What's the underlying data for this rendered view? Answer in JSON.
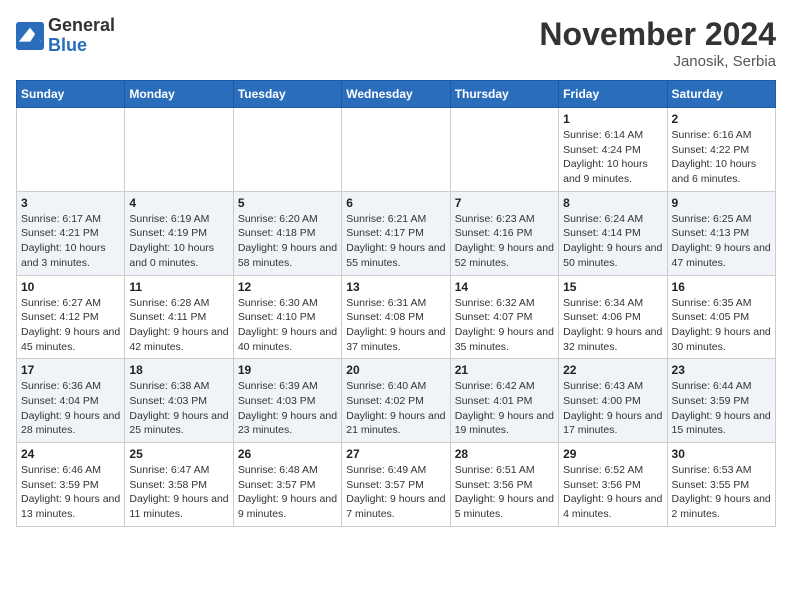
{
  "header": {
    "logo_general": "General",
    "logo_blue": "Blue",
    "month_title": "November 2024",
    "location": "Janosik, Serbia"
  },
  "days_of_week": [
    "Sunday",
    "Monday",
    "Tuesday",
    "Wednesday",
    "Thursday",
    "Friday",
    "Saturday"
  ],
  "weeks": [
    [
      {
        "day": "",
        "info": ""
      },
      {
        "day": "",
        "info": ""
      },
      {
        "day": "",
        "info": ""
      },
      {
        "day": "",
        "info": ""
      },
      {
        "day": "",
        "info": ""
      },
      {
        "day": "1",
        "info": "Sunrise: 6:14 AM\nSunset: 4:24 PM\nDaylight: 10 hours and 9 minutes."
      },
      {
        "day": "2",
        "info": "Sunrise: 6:16 AM\nSunset: 4:22 PM\nDaylight: 10 hours and 6 minutes."
      }
    ],
    [
      {
        "day": "3",
        "info": "Sunrise: 6:17 AM\nSunset: 4:21 PM\nDaylight: 10 hours and 3 minutes."
      },
      {
        "day": "4",
        "info": "Sunrise: 6:19 AM\nSunset: 4:19 PM\nDaylight: 10 hours and 0 minutes."
      },
      {
        "day": "5",
        "info": "Sunrise: 6:20 AM\nSunset: 4:18 PM\nDaylight: 9 hours and 58 minutes."
      },
      {
        "day": "6",
        "info": "Sunrise: 6:21 AM\nSunset: 4:17 PM\nDaylight: 9 hours and 55 minutes."
      },
      {
        "day": "7",
        "info": "Sunrise: 6:23 AM\nSunset: 4:16 PM\nDaylight: 9 hours and 52 minutes."
      },
      {
        "day": "8",
        "info": "Sunrise: 6:24 AM\nSunset: 4:14 PM\nDaylight: 9 hours and 50 minutes."
      },
      {
        "day": "9",
        "info": "Sunrise: 6:25 AM\nSunset: 4:13 PM\nDaylight: 9 hours and 47 minutes."
      }
    ],
    [
      {
        "day": "10",
        "info": "Sunrise: 6:27 AM\nSunset: 4:12 PM\nDaylight: 9 hours and 45 minutes."
      },
      {
        "day": "11",
        "info": "Sunrise: 6:28 AM\nSunset: 4:11 PM\nDaylight: 9 hours and 42 minutes."
      },
      {
        "day": "12",
        "info": "Sunrise: 6:30 AM\nSunset: 4:10 PM\nDaylight: 9 hours and 40 minutes."
      },
      {
        "day": "13",
        "info": "Sunrise: 6:31 AM\nSunset: 4:08 PM\nDaylight: 9 hours and 37 minutes."
      },
      {
        "day": "14",
        "info": "Sunrise: 6:32 AM\nSunset: 4:07 PM\nDaylight: 9 hours and 35 minutes."
      },
      {
        "day": "15",
        "info": "Sunrise: 6:34 AM\nSunset: 4:06 PM\nDaylight: 9 hours and 32 minutes."
      },
      {
        "day": "16",
        "info": "Sunrise: 6:35 AM\nSunset: 4:05 PM\nDaylight: 9 hours and 30 minutes."
      }
    ],
    [
      {
        "day": "17",
        "info": "Sunrise: 6:36 AM\nSunset: 4:04 PM\nDaylight: 9 hours and 28 minutes."
      },
      {
        "day": "18",
        "info": "Sunrise: 6:38 AM\nSunset: 4:03 PM\nDaylight: 9 hours and 25 minutes."
      },
      {
        "day": "19",
        "info": "Sunrise: 6:39 AM\nSunset: 4:03 PM\nDaylight: 9 hours and 23 minutes."
      },
      {
        "day": "20",
        "info": "Sunrise: 6:40 AM\nSunset: 4:02 PM\nDaylight: 9 hours and 21 minutes."
      },
      {
        "day": "21",
        "info": "Sunrise: 6:42 AM\nSunset: 4:01 PM\nDaylight: 9 hours and 19 minutes."
      },
      {
        "day": "22",
        "info": "Sunrise: 6:43 AM\nSunset: 4:00 PM\nDaylight: 9 hours and 17 minutes."
      },
      {
        "day": "23",
        "info": "Sunrise: 6:44 AM\nSunset: 3:59 PM\nDaylight: 9 hours and 15 minutes."
      }
    ],
    [
      {
        "day": "24",
        "info": "Sunrise: 6:46 AM\nSunset: 3:59 PM\nDaylight: 9 hours and 13 minutes."
      },
      {
        "day": "25",
        "info": "Sunrise: 6:47 AM\nSunset: 3:58 PM\nDaylight: 9 hours and 11 minutes."
      },
      {
        "day": "26",
        "info": "Sunrise: 6:48 AM\nSunset: 3:57 PM\nDaylight: 9 hours and 9 minutes."
      },
      {
        "day": "27",
        "info": "Sunrise: 6:49 AM\nSunset: 3:57 PM\nDaylight: 9 hours and 7 minutes."
      },
      {
        "day": "28",
        "info": "Sunrise: 6:51 AM\nSunset: 3:56 PM\nDaylight: 9 hours and 5 minutes."
      },
      {
        "day": "29",
        "info": "Sunrise: 6:52 AM\nSunset: 3:56 PM\nDaylight: 9 hours and 4 minutes."
      },
      {
        "day": "30",
        "info": "Sunrise: 6:53 AM\nSunset: 3:55 PM\nDaylight: 9 hours and 2 minutes."
      }
    ]
  ]
}
